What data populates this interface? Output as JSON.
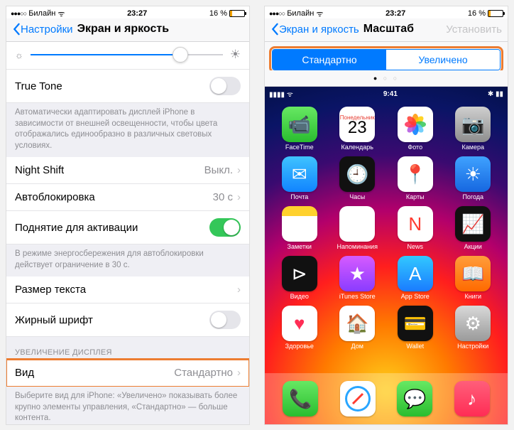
{
  "status": {
    "carrier": "Билайн",
    "wifi": "wifi",
    "time": "23:27",
    "battery_pct": "16 %"
  },
  "left": {
    "back": "Настройки",
    "title": "Экран и яркость",
    "rows": {
      "truetone": "True Tone",
      "truetone_note": "Автоматически адаптировать дисплей iPhone в зависимости от внешней освещенности, чтобы цвета отображались единообразно в различных световых условиях.",
      "nightshift": "Night Shift",
      "nightshift_val": "Выкл.",
      "autolock": "Автоблокировка",
      "autolock_val": "30 с",
      "raise": "Поднятие для активации",
      "raise_note": "В режиме энергосбережения для автоблокировки действует ограничение в 30 с.",
      "textsize": "Размер текста",
      "bold": "Жирный шрифт",
      "zoom_head": "УВЕЛИЧЕНИЕ ДИСПЛЕЯ",
      "view": "Вид",
      "view_val": "Стандартно",
      "view_note": "Выберите вид для iPhone: «Увеличено» показывать более крупно элементы управления, «Стандартно» — больше контента."
    }
  },
  "right": {
    "back": "Экран и яркость",
    "title": "Масштаб",
    "action": "Установить",
    "seg": {
      "std": "Стандартно",
      "zoom": "Увеличено"
    },
    "preview": {
      "time": "9:41",
      "cal_month": "Понедельник",
      "cal_day": "23",
      "apps": [
        {
          "n": "FaceTime",
          "c": "i-facetime",
          "g": "📹"
        },
        {
          "n": "Календарь",
          "c": "i-cal",
          "g": ""
        },
        {
          "n": "Фото",
          "c": "i-photos",
          "g": "✿"
        },
        {
          "n": "Камера",
          "c": "i-camera",
          "g": "📷"
        },
        {
          "n": "Почта",
          "c": "i-mail",
          "g": "✉"
        },
        {
          "n": "Часы",
          "c": "i-clock",
          "g": "🕘"
        },
        {
          "n": "Карты",
          "c": "i-maps",
          "g": "📍"
        },
        {
          "n": "Погода",
          "c": "i-weather",
          "g": "☀"
        },
        {
          "n": "Заметки",
          "c": "i-notes",
          "g": ""
        },
        {
          "n": "Напоминания",
          "c": "i-remind",
          "g": "≡"
        },
        {
          "n": "News",
          "c": "i-news",
          "g": "N"
        },
        {
          "n": "Акции",
          "c": "i-stocks",
          "g": "📈"
        },
        {
          "n": "Видео",
          "c": "i-tv",
          "g": "⊳"
        },
        {
          "n": "iTunes Store",
          "c": "i-itunes",
          "g": "★"
        },
        {
          "n": "App Store",
          "c": "i-appstore",
          "g": "A"
        },
        {
          "n": "Книги",
          "c": "i-books",
          "g": "📖"
        },
        {
          "n": "Здоровье",
          "c": "i-health",
          "g": "♥"
        },
        {
          "n": "Дом",
          "c": "i-home",
          "g": "🏠"
        },
        {
          "n": "Wallet",
          "c": "i-wallet",
          "g": "💳"
        },
        {
          "n": "Настройки",
          "c": "i-settings",
          "g": "⚙"
        }
      ],
      "dock": [
        {
          "n": "Phone",
          "c": "i-phone",
          "g": "📞"
        },
        {
          "n": "Safari",
          "c": "i-safari",
          "g": "🧭"
        },
        {
          "n": "Messages",
          "c": "i-msg",
          "g": "💬"
        },
        {
          "n": "Music",
          "c": "i-music",
          "g": "♪"
        }
      ]
    }
  }
}
